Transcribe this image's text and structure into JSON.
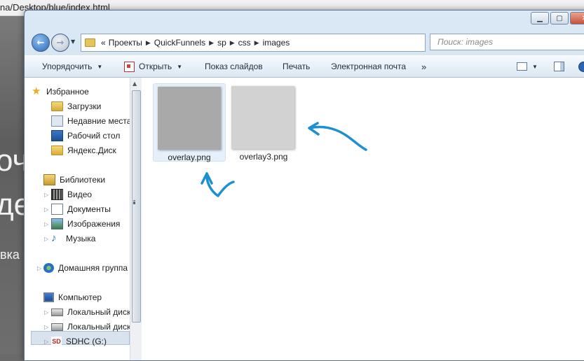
{
  "background_browser": {
    "url_fragment": "na/Desktop/blue/index.html",
    "heading_line1": "оч",
    "heading_line2": "де",
    "subtext": "вка и"
  },
  "window": {
    "buttons": [
      "minimize",
      "maximize",
      "close"
    ]
  },
  "address_bar": {
    "overflow_marker": "«",
    "crumbs": [
      "Проекты",
      "QuickFunnels",
      "sp",
      "css",
      "images"
    ]
  },
  "search": {
    "placeholder": "Поиск: images"
  },
  "toolbar": {
    "organize": "Упорядочить",
    "open": "Открыть",
    "slideshow": "Показ слайдов",
    "print": "Печать",
    "email": "Электронная почта",
    "more": "»"
  },
  "nav_pane": {
    "favorites": {
      "label": "Избранное",
      "items": [
        "Загрузки",
        "Недавние места",
        "Рабочий стол",
        "Яндекс.Диск"
      ]
    },
    "libraries": {
      "label": "Библиотеки",
      "items": [
        "Видео",
        "Документы",
        "Изображения",
        "Музыка"
      ]
    },
    "homegroup": "Домашняя группа",
    "computer": {
      "label": "Компьютер",
      "items": [
        "Локальный диск",
        "Локальный диск",
        "SDHC (G:)"
      ]
    }
  },
  "files": [
    {
      "name": "overlay.png",
      "selected": true,
      "color": "#a9a9a9"
    },
    {
      "name": "overlay3.png",
      "selected": false,
      "color": "#d2d2d2"
    }
  ],
  "annotation_color": "#1e90d0"
}
